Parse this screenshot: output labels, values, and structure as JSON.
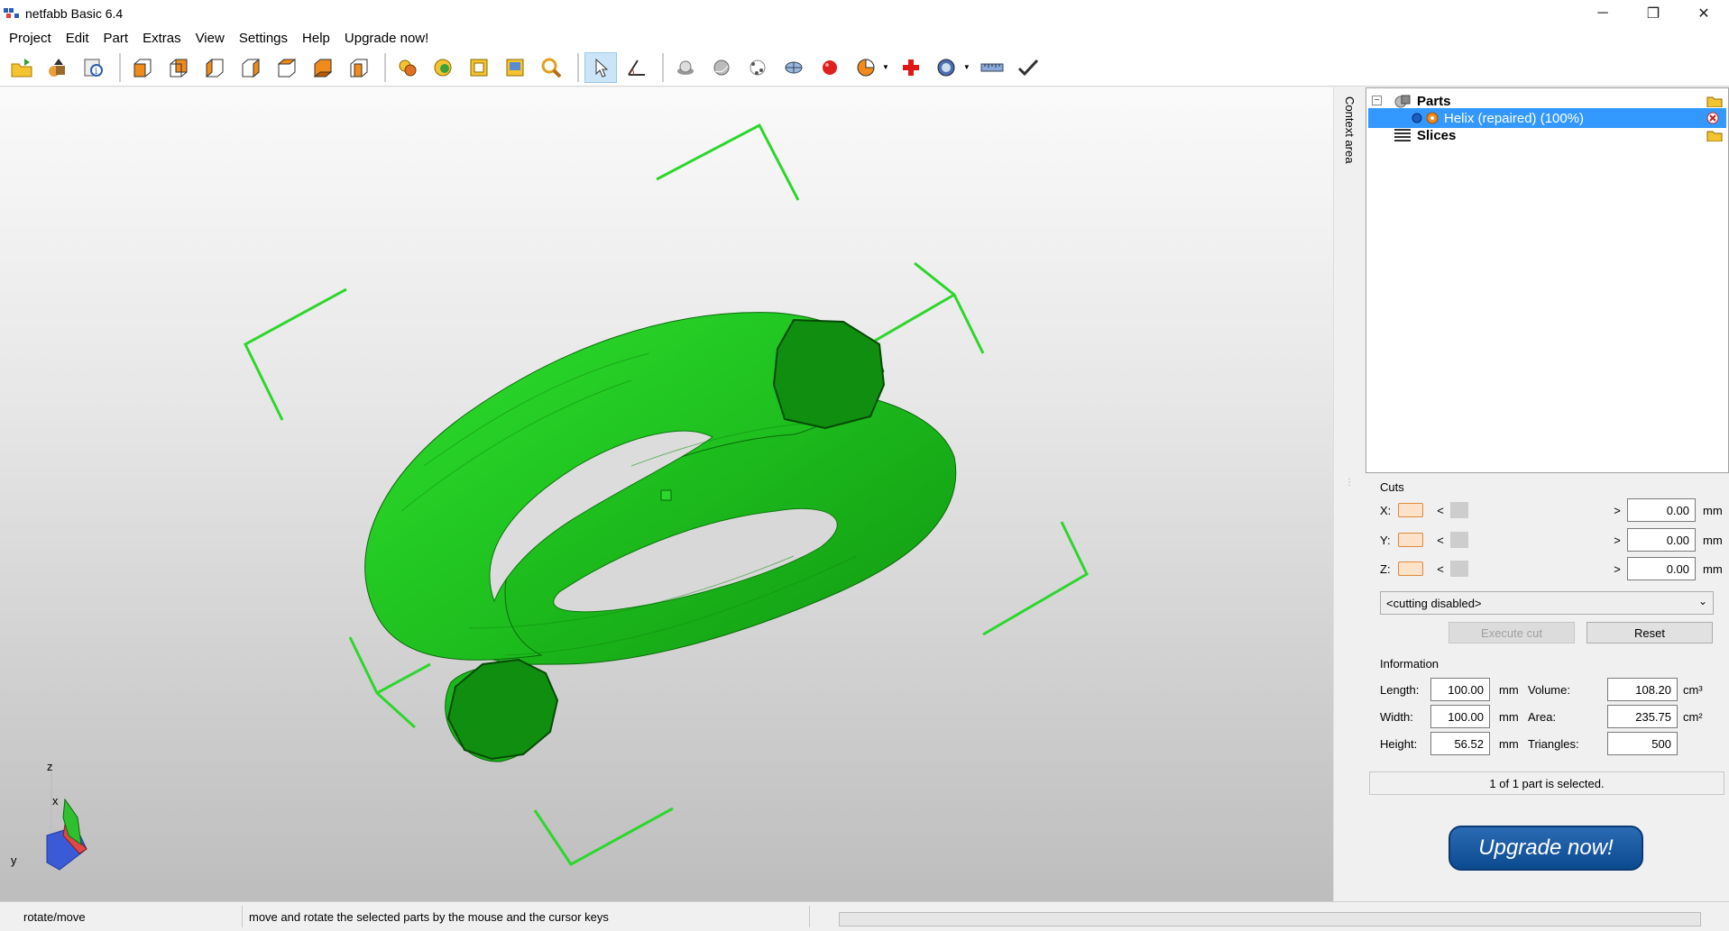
{
  "window": {
    "title": "netfabb Basic 6.4",
    "controls": {
      "minimize": "─",
      "maximize": "❐",
      "close": "✕"
    }
  },
  "menu": [
    "Project",
    "Edit",
    "Part",
    "Extras",
    "View",
    "Settings",
    "Help",
    "Upgrade now!"
  ],
  "toolbar": {
    "icons": [
      "open-project-icon",
      "add-part-icon",
      "part-info-icon",
      "view-front-icon",
      "view-back-icon",
      "view-left-icon",
      "view-right-icon",
      "view-top-icon",
      "view-bottom-icon",
      "view-iso-icon",
      "zoom-all-icon",
      "zoom-part-icon",
      "zoom-selection-icon",
      "zoom-window-icon",
      "zoom-magnifier-icon",
      "select-cursor-icon",
      "measure-angle-icon",
      "shade-icon",
      "shade-smooth-icon",
      "points-icon",
      "wireframe-icon",
      "sphere-icon",
      "pie-view-icon",
      "repair-cross-icon",
      "pan-dial-icon",
      "ruler-icon",
      "checkmark-icon"
    ],
    "selected_tool": "select-cursor-icon"
  },
  "context_area": {
    "label": "Context area"
  },
  "tree": {
    "root": "Parts",
    "part": "Helix (repaired) (100%)",
    "slices": "Slices"
  },
  "cuts": {
    "label": "Cuts",
    "rows": [
      {
        "axis": "X:",
        "value": "0.00",
        "unit": "mm"
      },
      {
        "axis": "Y:",
        "value": "0.00",
        "unit": "mm"
      },
      {
        "axis": "Z:",
        "value": "0.00",
        "unit": "mm"
      }
    ],
    "mode": "<cutting disabled>",
    "execute_label": "Execute cut",
    "reset_label": "Reset"
  },
  "information": {
    "label": "Information",
    "length": {
      "label": "Length:",
      "value": "100.00",
      "unit": "mm"
    },
    "width": {
      "label": "Width:",
      "value": "100.00",
      "unit": "mm"
    },
    "height": {
      "label": "Height:",
      "value": "56.52",
      "unit": "mm"
    },
    "volume": {
      "label": "Volume:",
      "value": "108.20",
      "unit": "cm³"
    },
    "area": {
      "label": "Area:",
      "value": "235.75",
      "unit": "cm²"
    },
    "triangles": {
      "label": "Triangles:",
      "value": "500"
    }
  },
  "selection_status": "1 of 1 part is selected.",
  "upgrade_button": "Upgrade now!",
  "axes": {
    "z": "z",
    "x": "x",
    "y": "y"
  },
  "statusbar": {
    "mode": "rotate/move",
    "hint": "move and rotate the selected parts by the mouse and the cursor keys"
  },
  "colors": {
    "model": "#1fcc1f",
    "model_dark": "#0e8a0e",
    "bracket": "#2dd62d",
    "selection": "#3399ff",
    "upgrade": "#0c4a90"
  }
}
